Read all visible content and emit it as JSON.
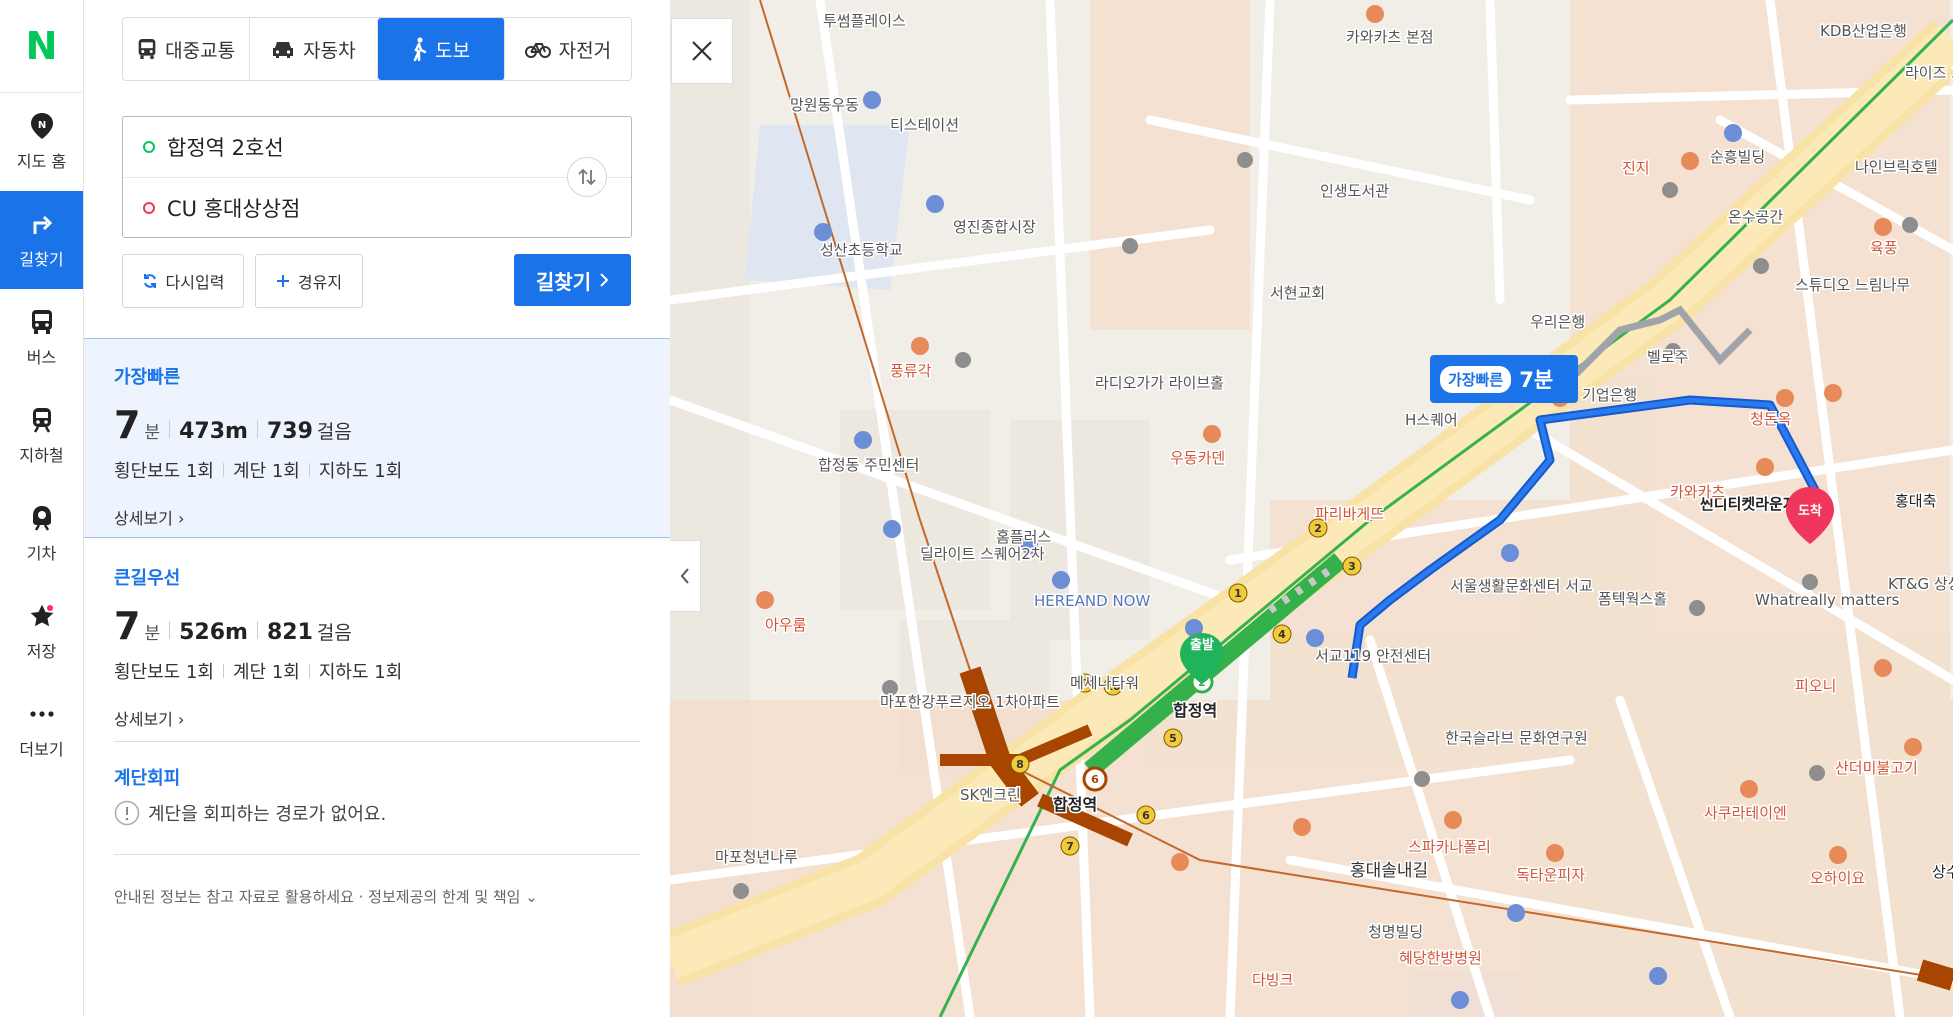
{
  "rail": {
    "logo": "N",
    "items": [
      {
        "label": "지도 홈",
        "icon": "map-pin-icon"
      },
      {
        "label": "길찾기",
        "icon": "directions-icon"
      },
      {
        "label": "버스",
        "icon": "bus-icon"
      },
      {
        "label": "지하철",
        "icon": "subway-icon"
      },
      {
        "label": "기차",
        "icon": "train-icon"
      },
      {
        "label": "저장",
        "icon": "star-icon"
      },
      {
        "label": "더보기",
        "icon": "more-icon"
      }
    ]
  },
  "modes": [
    {
      "label": "대중교통",
      "icon": "bus-icon"
    },
    {
      "label": "자동차",
      "icon": "car-icon"
    },
    {
      "label": "도보",
      "icon": "walk-icon"
    },
    {
      "label": "자전거",
      "icon": "bicycle-icon"
    }
  ],
  "search": {
    "origin": "합정역 2호선",
    "destination": "CU 홍대상상점",
    "reset_label": "다시입력",
    "waypoint_label": "경유지",
    "go_label": "길찾기"
  },
  "routes": [
    {
      "title": "가장빠른",
      "minutes": "7",
      "min_unit": "분",
      "distance": "473m",
      "steps": "739",
      "steps_unit": "걸음",
      "crosswalk": "횡단보도 1회",
      "stairs": "계단 1회",
      "underpass": "지하도 1회",
      "detail": "상세보기"
    },
    {
      "title": "큰길우선",
      "minutes": "7",
      "min_unit": "분",
      "distance": "526m",
      "steps": "821",
      "steps_unit": "걸음",
      "crosswalk": "횡단보도 1회",
      "stairs": "계단 1회",
      "underpass": "지하도 1회",
      "detail": "상세보기"
    }
  ],
  "avoid": {
    "title": "계단회피",
    "message": "계단을 회피하는 경로가 없어요."
  },
  "footer": "안내된 정보는 참고 자료로 활용하세요 · 정보제공의 한계 및 책임",
  "map": {
    "badge_label": "가장빠른",
    "badge_time": "7분",
    "start_label": "출발",
    "end_label": "도착",
    "labels": [
      "투썸플레이스",
      "카와카츠 본점",
      "KDB산업은행",
      "라이즈 그래프",
      "망원동우동",
      "티스테이션",
      "진지",
      "순흥빌딩",
      "나인브릭호텔",
      "인생도서관",
      "영진종합시장",
      "온수공간",
      "육풍",
      "성산초등학교",
      "서현교회",
      "우리은행",
      "스튜디오 느림나무",
      "풍류각",
      "라디오가가 라이브홀",
      "벨로주",
      "H스퀘어",
      "기업은행",
      "청돈옥",
      "합정동 주민센터",
      "우동카덴",
      "씬디티켓라운지",
      "홍대축",
      "카와카츠",
      "KT&G 상상마당",
      "파리바게뜨",
      "홈플러스",
      "딜라이트 스퀘어2차",
      "서울생활문화센터 서교",
      "폼텍웍스홀",
      "Whatreally matters",
      "HEREAND NOW",
      "아우룸",
      "서교119 안전센터",
      "메세나타워",
      "피오니",
      "합정역",
      "마포한강푸르지오 1차아파트",
      "한국슬라브 문화연구원",
      "산더미불고기",
      "SK엔크린",
      "사쿠라테이엔",
      "스파카나폴리",
      "독타운피자",
      "오하이요",
      "마포청년나루",
      "홍대솔내길",
      "청명빌딩",
      "혜당한방병원",
      "다빙크",
      "상수 카페"
    ]
  },
  "colors": {
    "accent": "#1a73e8",
    "naver": "#03c75a",
    "walk_route": "#1a63d6",
    "line2": "#2db84a",
    "line6": "#b34d0a",
    "end_pin": "#f0365a"
  }
}
